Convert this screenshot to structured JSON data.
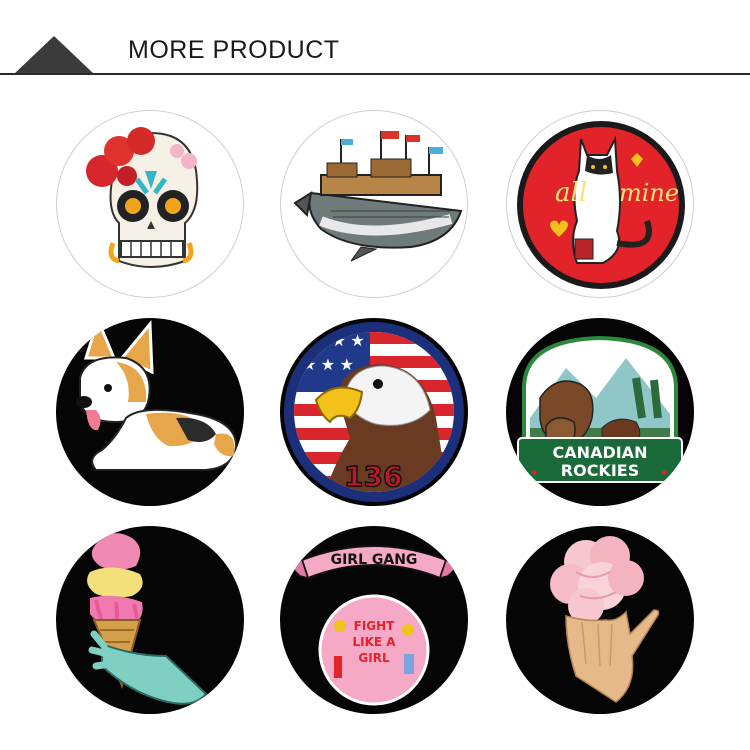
{
  "header": {
    "title": "MORE PRODUCT"
  },
  "products": [
    {
      "name": "sugar-skull-patch",
      "icon": "sugar-skull-icon",
      "text": ""
    },
    {
      "name": "whale-ship-patch",
      "icon": "whale-ship-icon",
      "text": ""
    },
    {
      "name": "all-mine-cat-patch",
      "icon": "cat-icon",
      "text_left": "all",
      "text_right": "mine"
    },
    {
      "name": "corgi-patch",
      "icon": "corgi-icon",
      "text": ""
    },
    {
      "name": "eagle-flag-patch",
      "icon": "eagle-icon",
      "text": "136"
    },
    {
      "name": "canadian-rockies-patch",
      "icon": "bears-icon",
      "text_line1": "CANADIAN",
      "text_line2": "ROCKIES"
    },
    {
      "name": "ice-cream-hand-patch",
      "icon": "ice-cream-icon",
      "text": ""
    },
    {
      "name": "girl-gang-patch",
      "icon": "girl-gang-icon",
      "banner": "GIRL GANG",
      "badge_line1": "FIGHT",
      "badge_line2": "LIKE A",
      "badge_line3": "GIRL"
    },
    {
      "name": "flower-hand-patch",
      "icon": "flower-hand-icon",
      "text": ""
    }
  ],
  "colors": {
    "rule": "#2a2a2a",
    "triangle": "#3b3b3b",
    "dark_bg": "#050505"
  }
}
